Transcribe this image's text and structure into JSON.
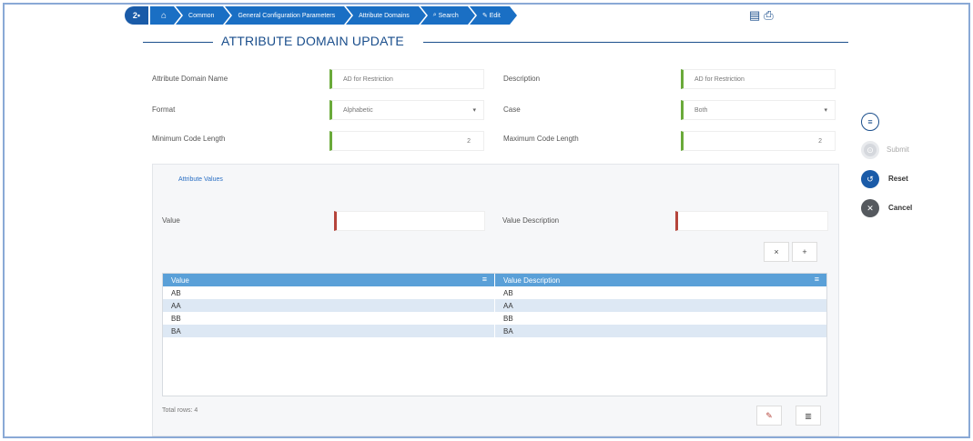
{
  "breadcrumb": {
    "home_logo": "2•",
    "home_icon": "⌂",
    "items": [
      "Common",
      "General Configuration Parameters",
      "Attribute Domains",
      "Search",
      "Edit"
    ],
    "search_icon": "search-icon",
    "edit_icon": "edit-icon"
  },
  "top_icons": [
    "save-icon",
    "print-icon"
  ],
  "page_title": "ATTRIBUTE DOMAIN UPDATE",
  "form": {
    "name_label": "Attribute Domain Name",
    "name_value": "AD for Restriction",
    "description_label": "Description",
    "description_value": "AD for Restriction",
    "format_label": "Format",
    "format_value": "Alphabetic",
    "case_label": "Case",
    "case_value": "Both",
    "min_label": "Minimum Code Length",
    "min_value": "2",
    "max_label": "Maximum Code Length",
    "max_value": "2"
  },
  "actions": {
    "menu_icon": "≡",
    "submit": "Submit",
    "reset": "Reset",
    "cancel": "Cancel"
  },
  "panel": {
    "tab": "Attribute Values",
    "value_label": "Value",
    "value_value": "",
    "value_desc_label": "Value Description",
    "value_desc_value": "",
    "clear_glyph": "×",
    "add_glyph": "+",
    "edit_glyph": "✎",
    "delete_glyph": "🗑"
  },
  "table": {
    "columns": [
      "Value",
      "Value Description"
    ],
    "rows": [
      [
        "AB",
        "AB"
      ],
      [
        "AA",
        "AA"
      ],
      [
        "BB",
        "BB"
      ],
      [
        "BA",
        "BA"
      ]
    ],
    "total": "Total rows: 4"
  },
  "colors": {
    "brand": "#1a4e8c",
    "breadcrumb": "#1a6fc4",
    "table_header": "#5aa0d8",
    "row_alt": "#dde8f4",
    "valid_marker": "#6aaa3a",
    "required_marker": "#b5443b"
  }
}
